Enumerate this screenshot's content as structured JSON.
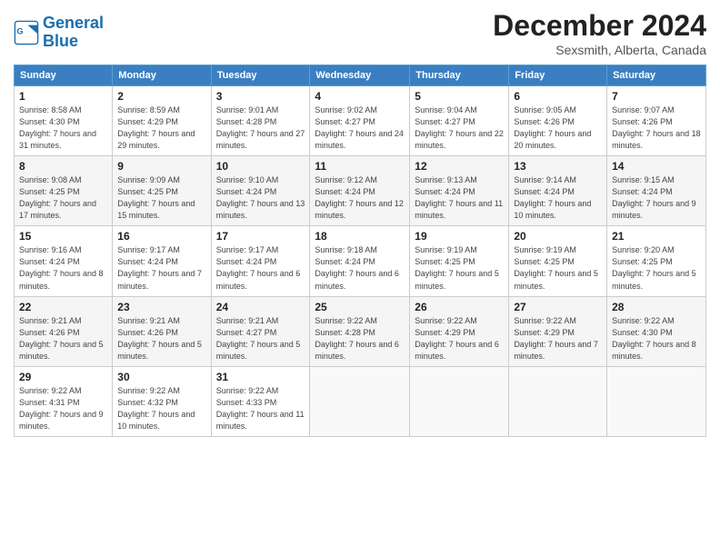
{
  "header": {
    "logo_line1": "General",
    "logo_line2": "Blue",
    "month": "December 2024",
    "location": "Sexsmith, Alberta, Canada"
  },
  "days_of_week": [
    "Sunday",
    "Monday",
    "Tuesday",
    "Wednesday",
    "Thursday",
    "Friday",
    "Saturday"
  ],
  "weeks": [
    [
      {
        "day": "1",
        "rise": "8:58 AM",
        "set": "4:30 PM",
        "daylight": "7 hours and 31 minutes."
      },
      {
        "day": "2",
        "rise": "8:59 AM",
        "set": "4:29 PM",
        "daylight": "7 hours and 29 minutes."
      },
      {
        "day": "3",
        "rise": "9:01 AM",
        "set": "4:28 PM",
        "daylight": "7 hours and 27 minutes."
      },
      {
        "day": "4",
        "rise": "9:02 AM",
        "set": "4:27 PM",
        "daylight": "7 hours and 24 minutes."
      },
      {
        "day": "5",
        "rise": "9:04 AM",
        "set": "4:27 PM",
        "daylight": "7 hours and 22 minutes."
      },
      {
        "day": "6",
        "rise": "9:05 AM",
        "set": "4:26 PM",
        "daylight": "7 hours and 20 minutes."
      },
      {
        "day": "7",
        "rise": "9:07 AM",
        "set": "4:26 PM",
        "daylight": "7 hours and 18 minutes."
      }
    ],
    [
      {
        "day": "8",
        "rise": "9:08 AM",
        "set": "4:25 PM",
        "daylight": "7 hours and 17 minutes."
      },
      {
        "day": "9",
        "rise": "9:09 AM",
        "set": "4:25 PM",
        "daylight": "7 hours and 15 minutes."
      },
      {
        "day": "10",
        "rise": "9:10 AM",
        "set": "4:24 PM",
        "daylight": "7 hours and 13 minutes."
      },
      {
        "day": "11",
        "rise": "9:12 AM",
        "set": "4:24 PM",
        "daylight": "7 hours and 12 minutes."
      },
      {
        "day": "12",
        "rise": "9:13 AM",
        "set": "4:24 PM",
        "daylight": "7 hours and 11 minutes."
      },
      {
        "day": "13",
        "rise": "9:14 AM",
        "set": "4:24 PM",
        "daylight": "7 hours and 10 minutes."
      },
      {
        "day": "14",
        "rise": "9:15 AM",
        "set": "4:24 PM",
        "daylight": "7 hours and 9 minutes."
      }
    ],
    [
      {
        "day": "15",
        "rise": "9:16 AM",
        "set": "4:24 PM",
        "daylight": "7 hours and 8 minutes."
      },
      {
        "day": "16",
        "rise": "9:17 AM",
        "set": "4:24 PM",
        "daylight": "7 hours and 7 minutes."
      },
      {
        "day": "17",
        "rise": "9:17 AM",
        "set": "4:24 PM",
        "daylight": "7 hours and 6 minutes."
      },
      {
        "day": "18",
        "rise": "9:18 AM",
        "set": "4:24 PM",
        "daylight": "7 hours and 6 minutes."
      },
      {
        "day": "19",
        "rise": "9:19 AM",
        "set": "4:25 PM",
        "daylight": "7 hours and 5 minutes."
      },
      {
        "day": "20",
        "rise": "9:19 AM",
        "set": "4:25 PM",
        "daylight": "7 hours and 5 minutes."
      },
      {
        "day": "21",
        "rise": "9:20 AM",
        "set": "4:25 PM",
        "daylight": "7 hours and 5 minutes."
      }
    ],
    [
      {
        "day": "22",
        "rise": "9:21 AM",
        "set": "4:26 PM",
        "daylight": "7 hours and 5 minutes."
      },
      {
        "day": "23",
        "rise": "9:21 AM",
        "set": "4:26 PM",
        "daylight": "7 hours and 5 minutes."
      },
      {
        "day": "24",
        "rise": "9:21 AM",
        "set": "4:27 PM",
        "daylight": "7 hours and 5 minutes."
      },
      {
        "day": "25",
        "rise": "9:22 AM",
        "set": "4:28 PM",
        "daylight": "7 hours and 6 minutes."
      },
      {
        "day": "26",
        "rise": "9:22 AM",
        "set": "4:29 PM",
        "daylight": "7 hours and 6 minutes."
      },
      {
        "day": "27",
        "rise": "9:22 AM",
        "set": "4:29 PM",
        "daylight": "7 hours and 7 minutes."
      },
      {
        "day": "28",
        "rise": "9:22 AM",
        "set": "4:30 PM",
        "daylight": "7 hours and 8 minutes."
      }
    ],
    [
      {
        "day": "29",
        "rise": "9:22 AM",
        "set": "4:31 PM",
        "daylight": "7 hours and 9 minutes."
      },
      {
        "day": "30",
        "rise": "9:22 AM",
        "set": "4:32 PM",
        "daylight": "7 hours and 10 minutes."
      },
      {
        "day": "31",
        "rise": "9:22 AM",
        "set": "4:33 PM",
        "daylight": "7 hours and 11 minutes."
      },
      null,
      null,
      null,
      null
    ]
  ]
}
